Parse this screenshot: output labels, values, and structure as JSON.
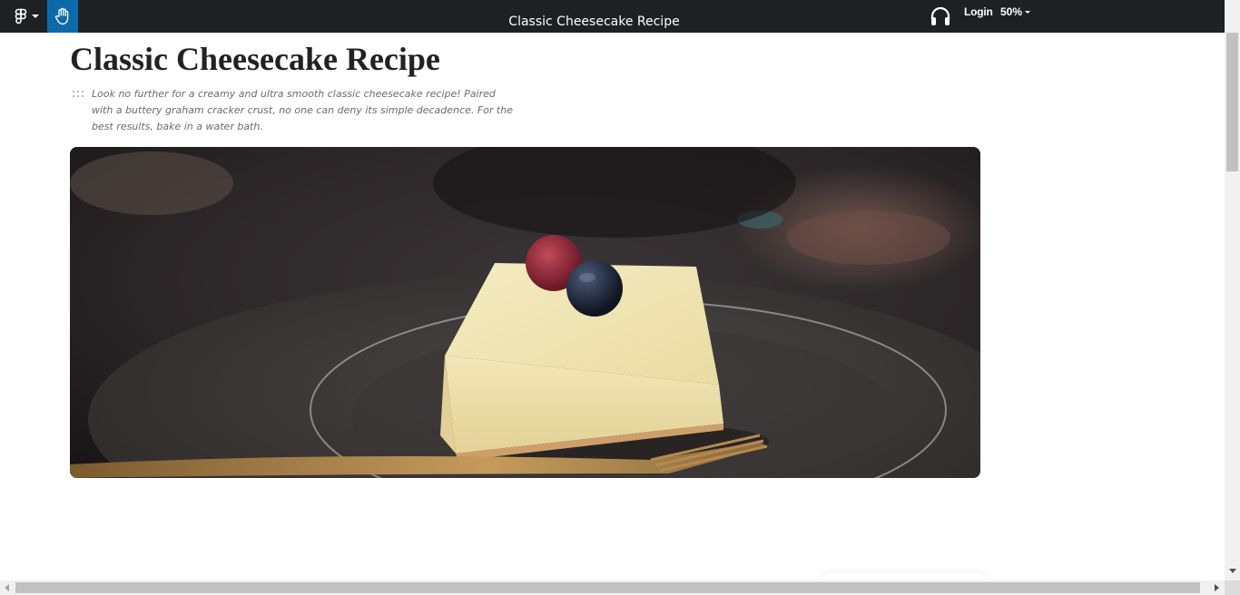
{
  "toolbar": {
    "figma_menu_icon": "figma-logo-icon",
    "hand_tool_icon": "hand-icon",
    "document_title": "Classic Cheesecake Recipe",
    "audio_icon": "headphones-icon",
    "login_label": "Login",
    "zoom_level": "50%"
  },
  "page": {
    "title": "Classic Cheesecake Recipe",
    "intro": "Look no further for a creamy and ultra smooth classic cheesecake recipe! Paired with a buttery graham cracker crust, no one can deny its simple decadence. For the best results, bake in a water bath.",
    "hero_image_icon": "cheesecake-photo"
  },
  "colors": {
    "toolbar_bg": "#1e2124",
    "active_tool": "#0d6aa8",
    "title_text": "#222222",
    "intro_text": "#6b6b6b"
  }
}
